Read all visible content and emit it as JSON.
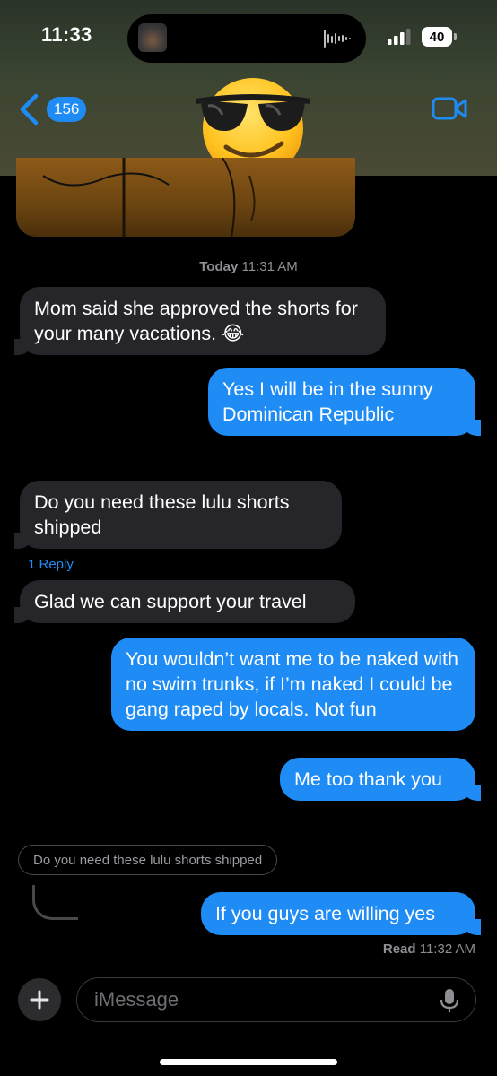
{
  "status_bar": {
    "time": "11:33",
    "battery": "40"
  },
  "header": {
    "back_count": "156"
  },
  "thread": {
    "timestamp_day": "Today",
    "timestamp_time": "11:31 AM",
    "messages": [
      {
        "from": "them",
        "text": "Mom said she approved the shorts for your many vacations. 😂"
      },
      {
        "from": "me",
        "text": "Yes I will be in the sunny Dominican Republic"
      },
      {
        "from": "them",
        "text": "Do you need these lulu shorts shipped"
      },
      {
        "from": "them",
        "text": "Glad we can support your travel"
      },
      {
        "from": "me",
        "text": "You wouldn’t want me to be naked with no swim trunks, if I’m naked I could be gang raped by locals. Not fun"
      },
      {
        "from": "me",
        "text": "Me too thank you"
      },
      {
        "from": "me",
        "text": "If you guys are willing yes"
      }
    ],
    "reply_link": "1 Reply",
    "quoted_reply": "Do you need these lulu shorts shipped",
    "read_label": "Read",
    "read_time": "11:32 AM"
  },
  "composer": {
    "placeholder": "iMessage"
  },
  "colors": {
    "sent_bubble": "#1f8cf5",
    "received_bubble": "#26252a",
    "background": "#000000"
  }
}
